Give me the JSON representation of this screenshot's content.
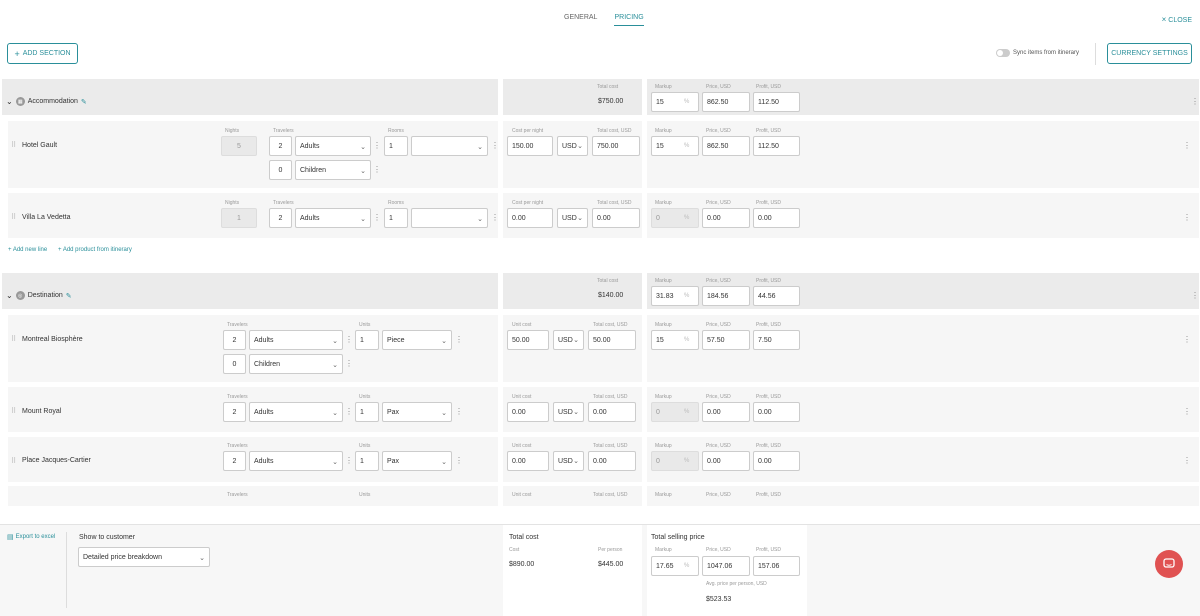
{
  "tabs": {
    "general": "GENERAL",
    "pricing": "PRICING"
  },
  "close_label": "CLOSE",
  "add_section": "ADD SECTION",
  "sync_label": "Sync items from itinerary",
  "currency_settings": "CURRENCY SETTINGS",
  "labels": {
    "total_cost": "Total cost",
    "markup": "Markup",
    "price_usd": "Price, USD",
    "profit_usd": "Profit, USD",
    "nights": "Nights",
    "travelers": "Travelers",
    "rooms": "Rooms",
    "cost_per_night": "Cost per night",
    "total_cost_usd": "Total cost, USD",
    "unit_cost": "Unit cost",
    "units": "Units",
    "pct": "%",
    "usd": "USD"
  },
  "accommodation": {
    "title": "Accommodation",
    "total": "$750.00",
    "markup": "15",
    "price": "862.50",
    "profit": "112.50",
    "rows": [
      {
        "name": "Hotel Gault",
        "nights": "5",
        "travelers": "2",
        "trav_type": "Adults",
        "children_count": "0",
        "children": "Children",
        "rooms": "1",
        "room_type": "",
        "cost": "150.00",
        "currency": "USD",
        "total": "750.00",
        "markup": "15",
        "price": "862.50",
        "profit": "112.50"
      },
      {
        "name": "Villa La Vedetta",
        "nights": "1",
        "travelers": "2",
        "trav_type": "Adults",
        "rooms": "1",
        "room_type": "",
        "cost": "0.00",
        "currency": "USD",
        "total": "0.00",
        "markup": "0",
        "price": "0.00",
        "profit": "0.00"
      }
    ],
    "add_line": "Add new line",
    "add_product": "Add product from itinerary"
  },
  "destination": {
    "title": "Destination",
    "total": "$140.00",
    "markup": "31.83",
    "price": "184.56",
    "profit": "44.56",
    "rows": [
      {
        "name": "Montreal Biosphère",
        "travelers": "2",
        "trav_type": "Adults",
        "children_count": "0",
        "children": "Children",
        "units": "1",
        "unit_type": "Piece",
        "cost": "50.00",
        "currency": "USD",
        "total": "50.00",
        "markup": "15",
        "price": "57.50",
        "profit": "7.50"
      },
      {
        "name": "Mount Royal",
        "travelers": "2",
        "trav_type": "Adults",
        "units": "1",
        "unit_type": "Pax",
        "cost": "0.00",
        "currency": "USD",
        "total": "0.00",
        "markup": "0",
        "price": "0.00",
        "profit": "0.00"
      },
      {
        "name": "Place Jacques-Cartier",
        "travelers": "2",
        "trav_type": "Adults",
        "units": "1",
        "unit_type": "Pax",
        "cost": "0.00",
        "currency": "USD",
        "total": "0.00",
        "markup": "0",
        "price": "0.00",
        "profit": "0.00"
      }
    ]
  },
  "footer": {
    "export": "Export to excel",
    "show_to_customer": "Show to customer",
    "breakdown": "Detailed price breakdown",
    "total_cost": "Total cost",
    "cost": "Cost",
    "per_person": "Per person",
    "cost_value": "$890.00",
    "per_person_value": "$445.00",
    "total_selling": "Total selling price",
    "markup": "17.65",
    "price": "1047.06",
    "profit": "157.06",
    "avg_label": "Avg. price per person, USD",
    "avg_value": "$523.53"
  }
}
